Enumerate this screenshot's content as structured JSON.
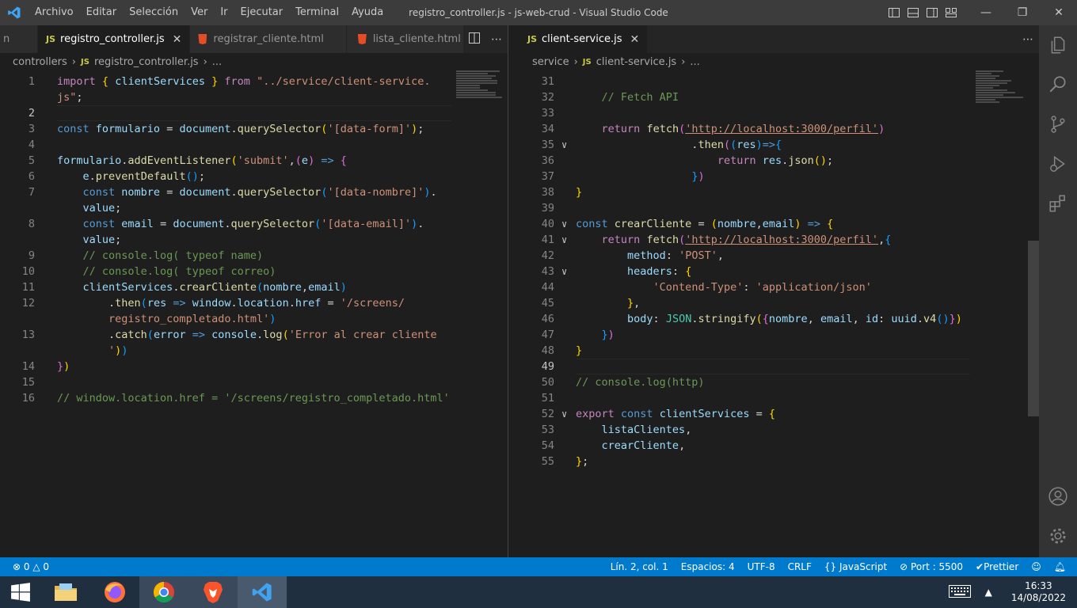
{
  "titlebar": {
    "title": "registro_controller.js - js-web-crud - Visual Studio Code",
    "menu": [
      "Archivo",
      "Editar",
      "Selección",
      "Ver",
      "Ir",
      "Ejecutar",
      "Terminal",
      "Ayuda"
    ]
  },
  "left_group": {
    "tabs": [
      {
        "label": "registro_controller.js",
        "icon": "JS",
        "active": true
      },
      {
        "label": "registrar_cliente.html",
        "icon": "html5-icon"
      },
      {
        "label": "lista_cliente.html",
        "icon": "html5-icon"
      }
    ],
    "breadcrumb": [
      "controllers",
      "registro_controller.js",
      "..."
    ],
    "lines": [
      {
        "n": "1",
        "html": "<span class='kc'>import</span> <span class='b1'>{</span> <span class='v'>clientServices</span> <span class='b1'>}</span> <span class='kc'>from</span> <span class='s'>\"../service/client-service.</span>"
      },
      {
        "n": "",
        "html": "<span class='s'>js\"</span>;"
      },
      {
        "n": "2",
        "html": "",
        "current": true
      },
      {
        "n": "3",
        "html": "<span class='k'>const</span> <span class='v'>formulario</span> = <span class='v'>document</span>.<span class='f'>querySelector</span><span class='b1'>(</span><span class='s'>'[data-form]'</span><span class='b1'>)</span>;"
      },
      {
        "n": "4",
        "html": ""
      },
      {
        "n": "5",
        "html": "<span class='v'>formulario</span>.<span class='f'>addEventListener</span><span class='b1'>(</span><span class='s'>'submit'</span>,<span class='b2'>(</span><span class='v'>e</span><span class='b2'>)</span> <span class='k'>=&gt;</span> <span class='b2'>{</span>"
      },
      {
        "n": "6",
        "html": "    <span class='v'>e</span>.<span class='f'>preventDefault</span><span class='b3'>()</span>;"
      },
      {
        "n": "7",
        "html": "    <span class='k'>const</span> <span class='v'>nombre</span> = <span class='v'>document</span>.<span class='f'>querySelector</span><span class='b3'>(</span><span class='s'>'[data-nombre]'</span><span class='b3'>)</span>."
      },
      {
        "n": "",
        "html": "    <span class='v'>value</span>;"
      },
      {
        "n": "8",
        "html": "    <span class='k'>const</span> <span class='v'>email</span> = <span class='v'>document</span>.<span class='f'>querySelector</span><span class='b3'>(</span><span class='s'>'[data-email]'</span><span class='b3'>)</span>."
      },
      {
        "n": "",
        "html": "    <span class='v'>value</span>;"
      },
      {
        "n": "9",
        "html": "    <span class='c'>// console.log( typeof name)</span>"
      },
      {
        "n": "10",
        "html": "    <span class='c'>// console.log( typeof correo)</span>"
      },
      {
        "n": "11",
        "html": "    <span class='v'>clientServices</span>.<span class='f'>crearCliente</span><span class='b3'>(</span><span class='v'>nombre</span>,<span class='v'>email</span><span class='b3'>)</span>"
      },
      {
        "n": "12",
        "html": "        .<span class='f'>then</span><span class='b3'>(</span><span class='v'>res</span> <span class='k'>=&gt;</span> <span class='v'>window</span>.<span class='v'>location</span>.<span class='v'>href</span> = <span class='s'>'/screens/</span>"
      },
      {
        "n": "",
        "html": "        <span class='s'>registro_completado.html'</span><span class='b3'>)</span>"
      },
      {
        "n": "13",
        "html": "        .<span class='f'>catch</span><span class='b3'>(</span><span class='v'>error</span> <span class='k'>=&gt;</span> <span class='v'>console</span>.<span class='f'>log</span><span class='b1'>(</span><span class='s'>'Error al crear cliente</span>"
      },
      {
        "n": "",
        "html": "        <span class='s'>'</span><span class='b1'>)</span><span class='b3'>)</span>"
      },
      {
        "n": "14",
        "html": "<span class='b2'>}</span><span class='b1'>)</span>"
      },
      {
        "n": "15",
        "html": ""
      },
      {
        "n": "16",
        "html": "<span class='c'>// window.location.href = '/screens/registro_completado.html'</span>"
      }
    ]
  },
  "right_group": {
    "tabs": [
      {
        "label": "client-service.js",
        "icon": "JS",
        "active": true
      }
    ],
    "breadcrumb": [
      "service",
      "client-service.js",
      "..."
    ],
    "lines": [
      {
        "n": "31",
        "html": ""
      },
      {
        "n": "32",
        "html": "    <span class='c'>// Fetch API</span>"
      },
      {
        "n": "33",
        "html": ""
      },
      {
        "n": "34",
        "html": "    <span class='kc'>return</span> <span class='f'>fetch</span><span class='b2'>(</span><span class='s u'>'http://localhost:3000/perfil'</span><span class='b2'>)</span>"
      },
      {
        "n": "35",
        "fold": true,
        "html": "                  .<span class='f'>then</span><span class='b2'>(</span><span class='b3'>(</span><span class='v'>res</span><span class='b3'>)</span><span class='k'>=&gt;</span><span class='b3'>{</span>"
      },
      {
        "n": "36",
        "html": "                      <span class='kc'>return</span> <span class='v'>res</span>.<span class='f'>json</span><span class='b1'>()</span>;"
      },
      {
        "n": "37",
        "html": "                  <span class='b3'>}</span><span class='b2'>)</span>"
      },
      {
        "n": "38",
        "html": "<span class='b1'>}</span>"
      },
      {
        "n": "39",
        "html": ""
      },
      {
        "n": "40",
        "fold": true,
        "html": "<span class='k'>const</span> <span class='f'>crearCliente</span> = <span class='b1'>(</span><span class='v'>nombre</span>,<span class='v'>email</span><span class='b1'>)</span> <span class='k'>=&gt;</span> <span class='b1'>{</span>"
      },
      {
        "n": "41",
        "fold": true,
        "html": "    <span class='kc'>return</span> <span class='f'>fetch</span><span class='b2'>(</span><span class='s u'>'http://localhost:3000/perfil'</span>,<span class='b3'>{</span>"
      },
      {
        "n": "42",
        "html": "        <span class='v'>method</span>: <span class='s'>'POST'</span>,"
      },
      {
        "n": "43",
        "fold": true,
        "html": "        <span class='v'>headers</span>: <span class='b1'>{</span>"
      },
      {
        "n": "44",
        "html": "            <span class='s'>'Contend-Type'</span>: <span class='s'>'application/json'</span>"
      },
      {
        "n": "45",
        "html": "        <span class='b1'>}</span>,"
      },
      {
        "n": "46",
        "html": "        <span class='v'>body</span>: <span class='t'>JSON</span>.<span class='f'>stringify</span><span class='b1'>(</span><span class='b2'>{</span><span class='v'>nombre</span>, <span class='v'>email</span>, <span class='v'>id</span>: <span class='v'>uuid</span>.<span class='f'>v4</span><span class='b3'>()</span><span class='b2'>}</span><span class='b1'>)</span>"
      },
      {
        "n": "47",
        "html": "    <span class='b3'>}</span><span class='b2'>)</span>"
      },
      {
        "n": "48",
        "html": "<span class='b1'>}</span>"
      },
      {
        "n": "49",
        "html": "",
        "current": true
      },
      {
        "n": "50",
        "html": "<span class='c'>// console.log(http)</span>"
      },
      {
        "n": "51",
        "html": ""
      },
      {
        "n": "52",
        "fold": true,
        "html": "<span class='kc'>export</span> <span class='k'>const</span> <span class='v'>clientServices</span> = <span class='b1'>{</span>"
      },
      {
        "n": "53",
        "html": "    <span class='v'>listaClientes</span>,"
      },
      {
        "n": "54",
        "html": "    <span class='v'>crearCliente</span>,"
      },
      {
        "n": "55",
        "html": "<span class='b1'>}</span>;"
      }
    ]
  },
  "statusbar": {
    "errors": "0",
    "warnings": "0",
    "position": "Lín. 2, col. 1",
    "spaces": "Espacios: 4",
    "encoding": "UTF-8",
    "eol": "CRLF",
    "language": "JavaScript",
    "port": "Port : 5500",
    "prettier": "Prettier"
  },
  "taskbar": {
    "time": "16:33",
    "date": "14/08/2022"
  },
  "colors": {
    "accent": "#007acc",
    "titlebar": "#3c3c3c",
    "editor_bg": "#1e1e1e"
  }
}
